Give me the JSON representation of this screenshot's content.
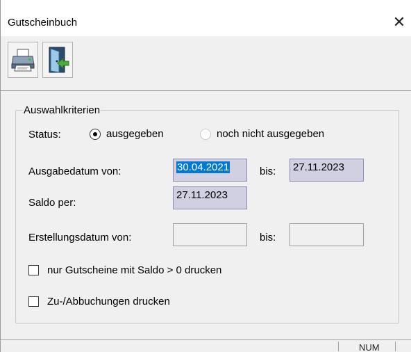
{
  "window": {
    "title": "Gutscheinbuch",
    "close_glyph": "✕"
  },
  "toolbar": {
    "buttons": [
      {
        "name": "print",
        "icon": "printer-icon"
      },
      {
        "name": "exit",
        "icon": "exit-door-icon"
      }
    ]
  },
  "criteria": {
    "legend": "Auswahlkriterien",
    "status_label": "Status:",
    "status_options": [
      {
        "label": "ausgegeben",
        "selected": true
      },
      {
        "label": "noch nicht ausgegeben",
        "selected": false
      }
    ],
    "ausgabedatum_label": "Ausgabedatum von:",
    "ausgabedatum_from": "30.04.2021",
    "ausgabedatum_bis_label": "bis:",
    "ausgabedatum_to": "27.11.2023",
    "saldo_label": "Saldo per:",
    "saldo_value": "27.11.2023",
    "erstellungsdatum_label": "Erstellungsdatum von:",
    "erstellungsdatum_from": "",
    "erstellungsdatum_bis_label": "bis:",
    "erstellungsdatum_to": "",
    "checkbox_saldo_label": "nur Gutscheine mit Saldo > 0 drucken",
    "checkbox_saldo_checked": false,
    "checkbox_buchungen_label": "Zu-/Abbuchungen drucken",
    "checkbox_buchungen_checked": false
  },
  "statusbar": {
    "num": "NUM"
  }
}
